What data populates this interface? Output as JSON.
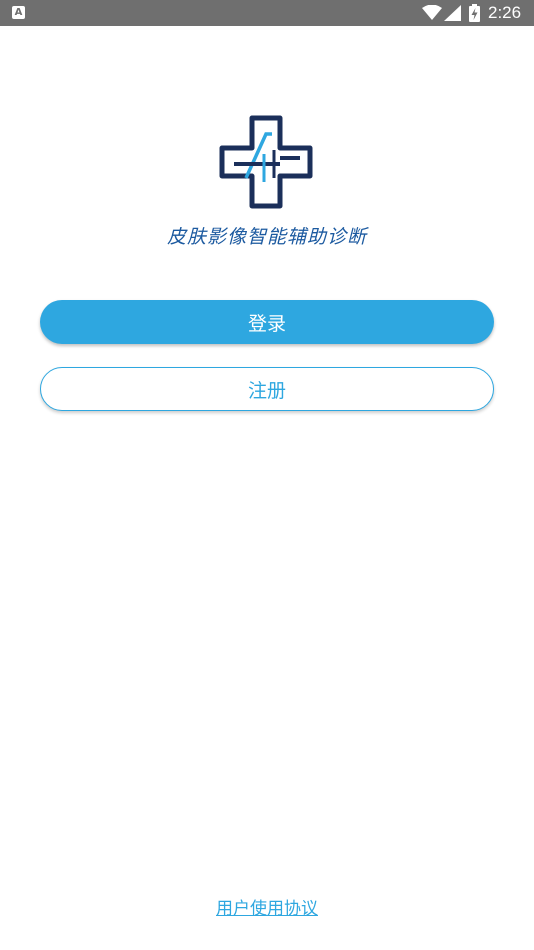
{
  "status_bar": {
    "notification_icon": "a-letter-icon",
    "notification_letter": "A",
    "wifi_icon": "wifi-icon",
    "signal_icon": "cell-signal-icon",
    "battery_icon": "battery-charging-icon",
    "time": "2:26"
  },
  "app": {
    "logo_icon": "medical-cross-ai-logo",
    "title": "皮肤影像智能辅助诊断"
  },
  "actions": {
    "login_label": "登录",
    "register_label": "注册"
  },
  "footer": {
    "agreement_link": "用户使用协议"
  },
  "colors": {
    "accent": "#2ea7e0",
    "title_blue": "#1c5aa0",
    "logo_navy": "#1b2f5a",
    "status_bar": "#6f6f6f"
  }
}
